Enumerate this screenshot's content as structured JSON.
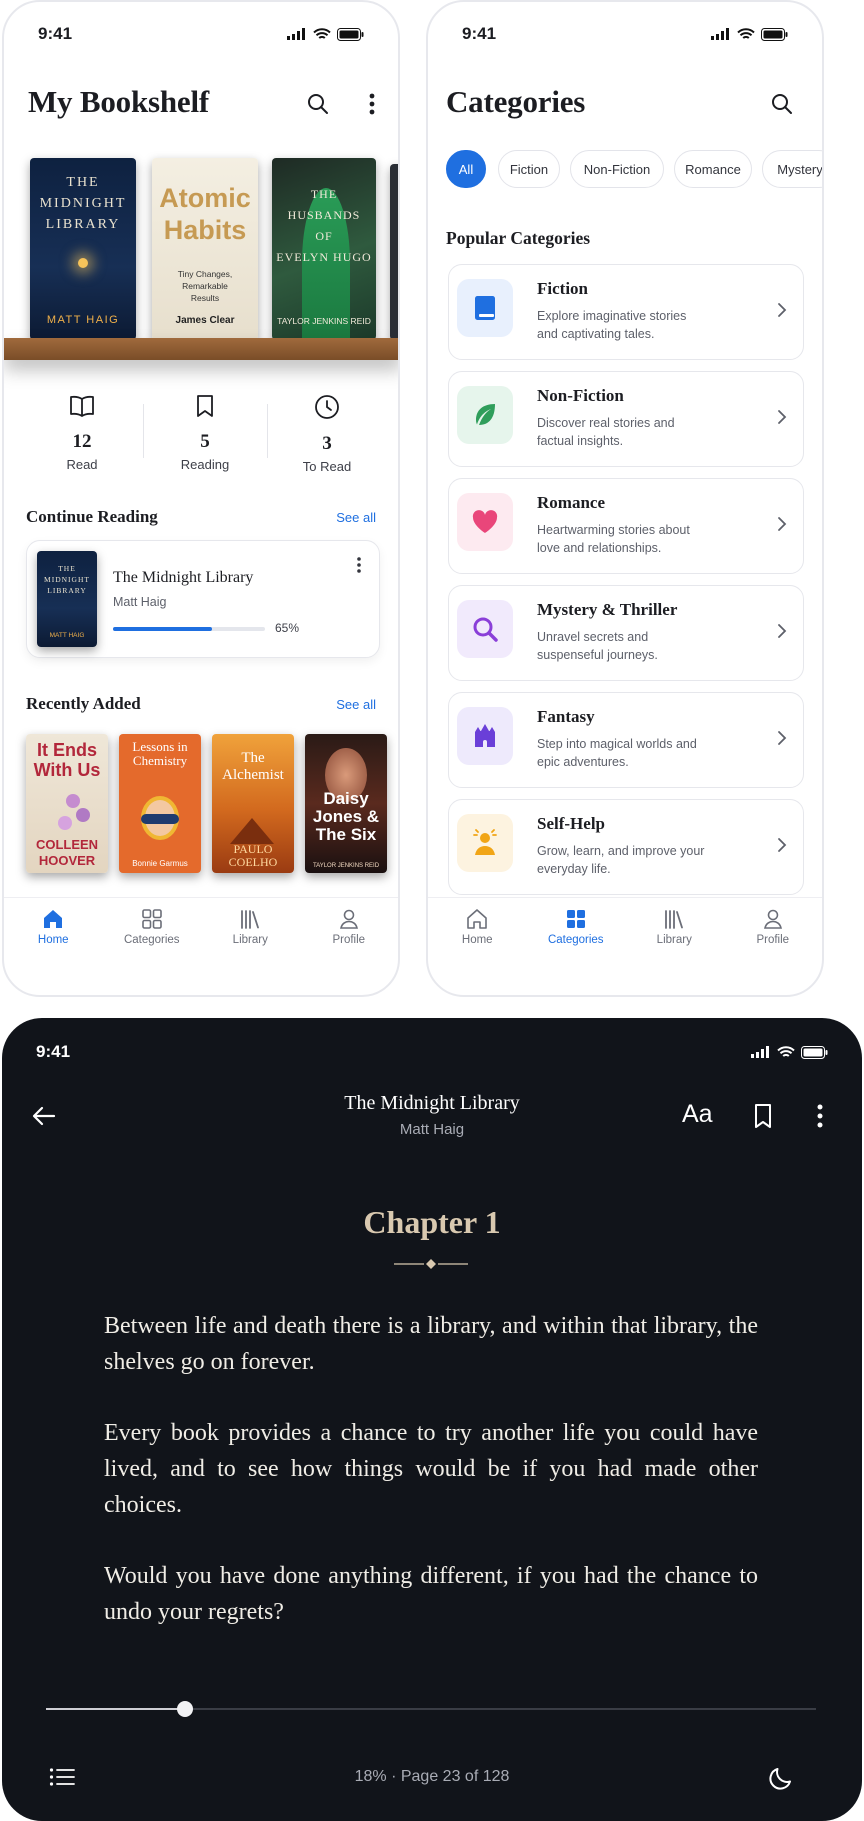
{
  "status_time": "9:41",
  "bookshelf": {
    "title": "My Bookshelf",
    "books": [
      {
        "title_lines": [
          "THE",
          "MIDNIGHT",
          "LIBRARY"
        ],
        "author": "MATT HAIG"
      },
      {
        "title_lines": [
          "Atomic",
          "Habits"
        ],
        "subtitle": "Tiny Changes, Remarkable Results",
        "author": "James Clear"
      },
      {
        "title_lines": [
          "THE",
          "HUSBANDS",
          "OF",
          "EVELYN HUGO"
        ],
        "author": "TAYLOR JENKINS REID"
      }
    ],
    "stats": [
      {
        "value": "12",
        "label": "Read",
        "icon": "open-book-icon"
      },
      {
        "value": "5",
        "label": "Reading",
        "icon": "bookmark-icon"
      },
      {
        "value": "3",
        "label": "To Read",
        "icon": "clock-icon"
      }
    ],
    "continue_reading": {
      "heading": "Continue Reading",
      "see_all": "See all",
      "book_title": "The Midnight Library",
      "author": "Matt Haig",
      "progress_label": "65%",
      "progress": 0.65,
      "cover_lines": [
        "THE",
        "MIDNIGHT",
        "LIBRARY"
      ],
      "cover_author": "MATT HAIG"
    },
    "recently_added": {
      "heading": "Recently Added",
      "see_all": "See all",
      "books": [
        {
          "title": "It Ends With Us",
          "author": "COLLEEN HOOVER"
        },
        {
          "title": "Lessons in Chemistry",
          "author": "Bonnie Garmus"
        },
        {
          "title": "The Alchemist",
          "author": "PAULO COELHO"
        },
        {
          "title": "Daisy Jones & The Six",
          "author": "TAYLOR JENKINS REID"
        }
      ]
    }
  },
  "categories_screen": {
    "title": "Categories",
    "chips": [
      "All",
      "Fiction",
      "Non-Fiction",
      "Romance",
      "Mystery"
    ],
    "popular_heading": "Popular Categories",
    "items": [
      {
        "name": "Fiction",
        "desc": "Explore imaginative stories and captivating tales.",
        "icon": "book-icon",
        "color": "#1f6fe0",
        "bg": "#e8f0fd"
      },
      {
        "name": "Non-Fiction",
        "desc": "Discover real stories and factual insights.",
        "icon": "leaf-icon",
        "color": "#2f9e5b",
        "bg": "#e6f5ec"
      },
      {
        "name": "Romance",
        "desc": "Heartwarming stories about love and relationships.",
        "icon": "heart-icon",
        "color": "#e9467a",
        "bg": "#fdeaf0"
      },
      {
        "name": "Mystery & Thriller",
        "desc": "Unravel secrets and suspenseful journeys.",
        "icon": "magnifier-icon",
        "color": "#8a3fd8",
        "bg": "#f1eafc"
      },
      {
        "name": "Fantasy",
        "desc": "Step into magical worlds and epic adventures.",
        "icon": "castle-icon",
        "color": "#6a3fd8",
        "bg": "#eeeafc"
      },
      {
        "name": "Self-Help",
        "desc": "Grow, learn, and improve your everyday life.",
        "icon": "person-sun-icon",
        "color": "#f1a516",
        "bg": "#fdf3e0"
      }
    ]
  },
  "tabs": [
    "Home",
    "Categories",
    "Library",
    "Profile"
  ],
  "reader": {
    "book_title": "The Midnight Library",
    "author": "Matt Haig",
    "font_button": "Aa",
    "chapter": "Chapter 1",
    "paragraphs": [
      "Between life and death there is a library, and within that library, the shelves go on forever.",
      "Every book provides a chance to try another life you could have lived, and to see how things would be if you had made other choices.",
      "Would you have done anything different, if you had the chance to undo your regrets?"
    ],
    "progress": 0.18,
    "progress_label": "18%",
    "separator": "·",
    "page_label": "Page 23 of 128"
  },
  "colors": {
    "accent": "#1f6fe0",
    "reader_bg": "#11141a",
    "reader_text": "#f0ede6",
    "chapter_color": "#d9c9b0"
  }
}
